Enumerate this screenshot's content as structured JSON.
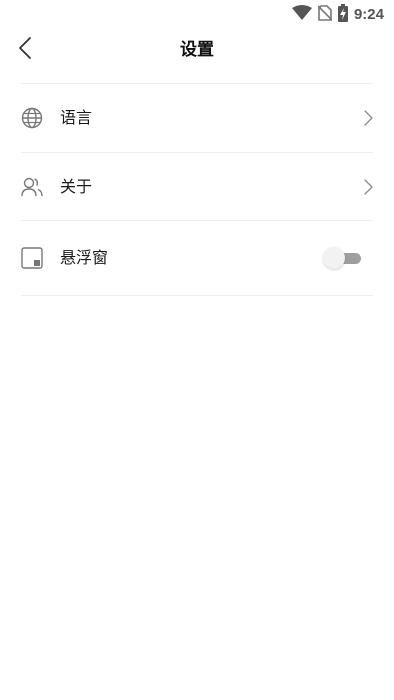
{
  "status_bar": {
    "time": "9:24",
    "icons": [
      "wifi-icon",
      "no-sim-icon",
      "battery-charging-icon"
    ]
  },
  "header": {
    "title": "设置",
    "back_icon": "chevron-left-icon"
  },
  "settings": {
    "items": [
      {
        "label": "语言",
        "icon": "globe-icon",
        "accessory": "chevron-right-icon"
      },
      {
        "label": "关于",
        "icon": "users-icon",
        "accessory": "chevron-right-icon"
      },
      {
        "label": "悬浮窗",
        "icon": "floating-window-icon",
        "accessory": "toggle",
        "toggle_on": false
      }
    ]
  },
  "colors": {
    "divider": "#eeeeee",
    "text": "#1a1a1a",
    "icon": "#777777",
    "toggle_track": "#9e9e9e",
    "toggle_thumb": "#f2f2f2"
  }
}
